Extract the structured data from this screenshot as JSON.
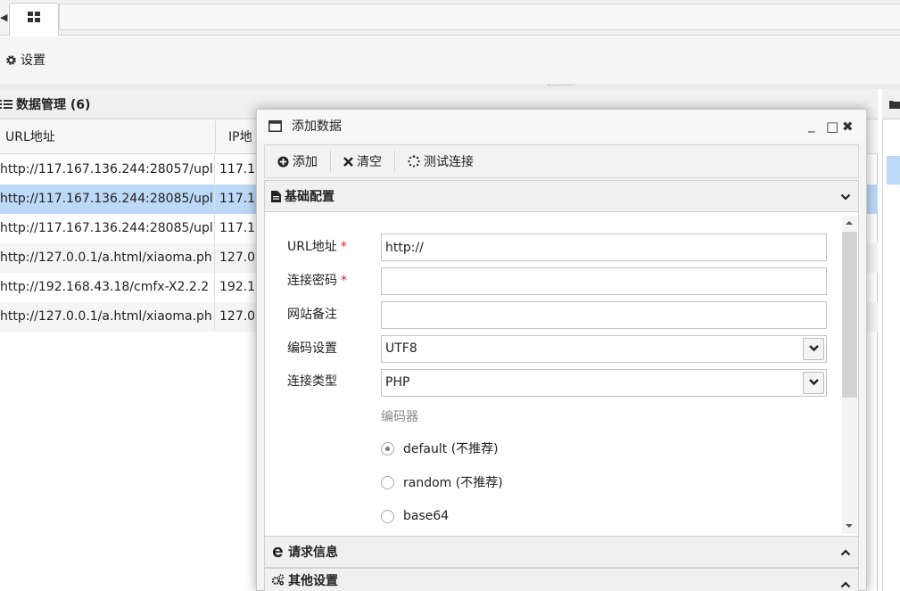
{
  "tabs": {
    "prev_arrow": "◀",
    "home_icon": "grid-icon"
  },
  "toolbar": {
    "settings_label": "设置"
  },
  "data_panel": {
    "title": "数据管理 (6)",
    "columns": [
      "URL地址",
      "IP地"
    ],
    "rows": [
      {
        "url": "http://117.167.136.244:28057/upl",
        "ip": "117.1"
      },
      {
        "url": "http://117.167.136.244:28085/upl",
        "ip": "117.1"
      },
      {
        "url": "http://117.167.136.244:28085/upl",
        "ip": "117.1"
      },
      {
        "url": "http://127.0.0.1/a.html/xiaoma.ph",
        "ip": "127.0"
      },
      {
        "url": "http://192.168.43.18/cmfx-X2.2.2",
        "ip": "192.1"
      },
      {
        "url": "http://127.0.0.1/a.html/xiaoma.ph",
        "ip": "127.0"
      }
    ],
    "selected_row_index": 1
  },
  "dialog": {
    "title": "添加数据",
    "window_buttons": {
      "minimize": "_",
      "maximize": "□",
      "close": "✖"
    },
    "toolbar": {
      "add": "添加",
      "clear": "清空",
      "test": "测试连接"
    },
    "sections": {
      "basic": "基础配置",
      "request": "请求信息",
      "other": "其他设置"
    },
    "form": {
      "url_label": "URL地址",
      "url_value": "http://",
      "password_label": "连接密码",
      "password_value": "",
      "note_label": "网站备注",
      "note_value": "",
      "encoding_label": "编码设置",
      "encoding_value": "UTF8",
      "type_label": "连接类型",
      "type_value": "PHP",
      "encoder_label": "编码器",
      "encoders": [
        "default (不推荐)",
        "random (不推荐)",
        "base64"
      ],
      "encoder_selected": "default (不推荐)",
      "required_mark": "*"
    }
  },
  "colors": {
    "selected_row": "#bcd9f7",
    "required": "#e02020"
  }
}
